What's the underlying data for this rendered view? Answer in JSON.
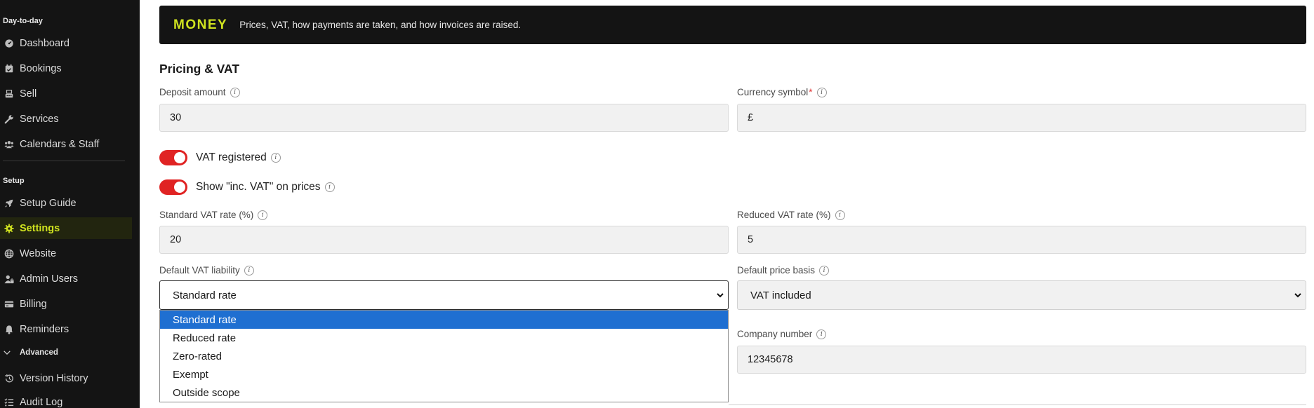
{
  "sidebar": {
    "day_label": "Day-to-day",
    "setup_label": "Setup",
    "advanced_label": "Advanced",
    "items": [
      {
        "label": "Dashboard"
      },
      {
        "label": "Bookings"
      },
      {
        "label": "Sell"
      },
      {
        "label": "Services"
      },
      {
        "label": "Calendars & Staff"
      },
      {
        "label": "Setup Guide"
      },
      {
        "label": "Settings"
      },
      {
        "label": "Website"
      },
      {
        "label": "Admin Users"
      },
      {
        "label": "Billing"
      },
      {
        "label": "Reminders"
      },
      {
        "label": "Version History"
      },
      {
        "label": "Audit Log"
      }
    ],
    "active_item": "Settings"
  },
  "banner": {
    "title": "MONEY",
    "subtitle": "Prices, VAT, how payments are taken, and how invoices are raised."
  },
  "section": {
    "title": "Pricing & VAT"
  },
  "fields": {
    "deposit": {
      "label": "Deposit amount",
      "value": "30"
    },
    "currency": {
      "label": "Currency symbol",
      "required_mark": "*",
      "value": "£"
    },
    "vat_registered": {
      "label": "VAT registered",
      "on": true
    },
    "show_inc_vat": {
      "label": "Show \"inc. VAT\" on prices",
      "on": true
    },
    "standard_vat": {
      "label": "Standard VAT rate (%)",
      "value": "20"
    },
    "reduced_vat": {
      "label": "Reduced VAT rate (%)",
      "value": "5"
    },
    "vat_liability": {
      "label": "Default VAT liability",
      "value": "Standard rate",
      "options": [
        "Standard rate",
        "Reduced rate",
        "Zero-rated",
        "Exempt",
        "Outside scope"
      ],
      "highlighted": "Standard rate"
    },
    "price_basis": {
      "label": "Default price basis",
      "value": "VAT included"
    },
    "company_number": {
      "label": "Company number",
      "value": "12345678"
    }
  },
  "info_glyph": "i",
  "colors": {
    "sidebar_bg": "#141414",
    "accent": "#cfe21f",
    "toggle_on": "#e02323",
    "dropdown_highlight": "#1f6fd1"
  }
}
